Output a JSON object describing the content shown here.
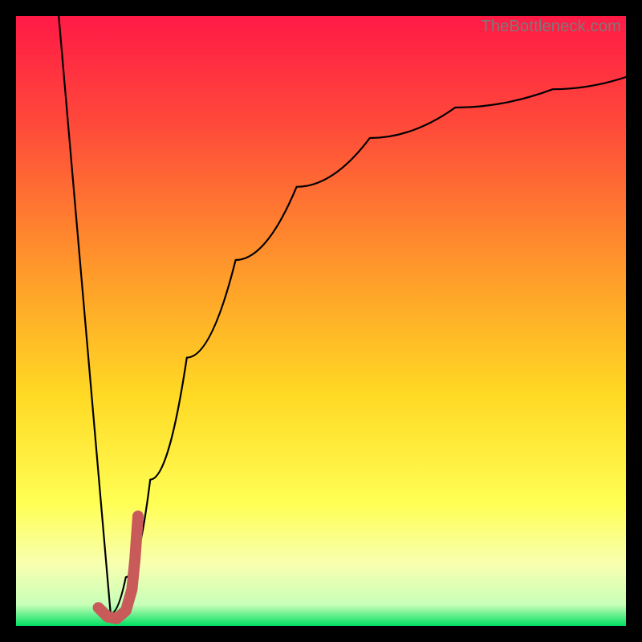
{
  "watermark": "TheBottleneck.com",
  "colors": {
    "bg": "#000000",
    "grad_top": "#ff1a46",
    "grad_mid1": "#ff7a2b",
    "grad_mid2": "#ffd924",
    "grad_mid3": "#ffff66",
    "grad_low": "#f4ffcc",
    "grad_bottom": "#00e060",
    "curve": "#000000",
    "accent": "#c85a5a"
  },
  "chart_data": {
    "type": "line",
    "title": "",
    "xlabel": "",
    "ylabel": "",
    "xlim": [
      0,
      100
    ],
    "ylim": [
      0,
      100
    ],
    "series": [
      {
        "name": "left-branch",
        "x": [
          7,
          15.5
        ],
        "values": [
          100,
          2
        ]
      },
      {
        "name": "right-branch",
        "x": [
          15.5,
          18,
          22,
          28,
          36,
          46,
          58,
          72,
          88,
          100
        ],
        "values": [
          2,
          8,
          24,
          44,
          60,
          72,
          80,
          85,
          88,
          90
        ]
      },
      {
        "name": "accent-j",
        "x": [
          13.5,
          15,
          16.5,
          18,
          19,
          19.5,
          20
        ],
        "values": [
          3,
          1.5,
          1.2,
          2.5,
          6,
          11,
          18
        ]
      }
    ],
    "gradient_stops": [
      {
        "offset": 0.0,
        "color": "#ff1a46"
      },
      {
        "offset": 0.18,
        "color": "#ff4a3a"
      },
      {
        "offset": 0.42,
        "color": "#ff9a2a"
      },
      {
        "offset": 0.62,
        "color": "#ffd924"
      },
      {
        "offset": 0.8,
        "color": "#ffff55"
      },
      {
        "offset": 0.9,
        "color": "#f7ffb0"
      },
      {
        "offset": 0.965,
        "color": "#c8ffb8"
      },
      {
        "offset": 1.0,
        "color": "#00e060"
      }
    ]
  }
}
